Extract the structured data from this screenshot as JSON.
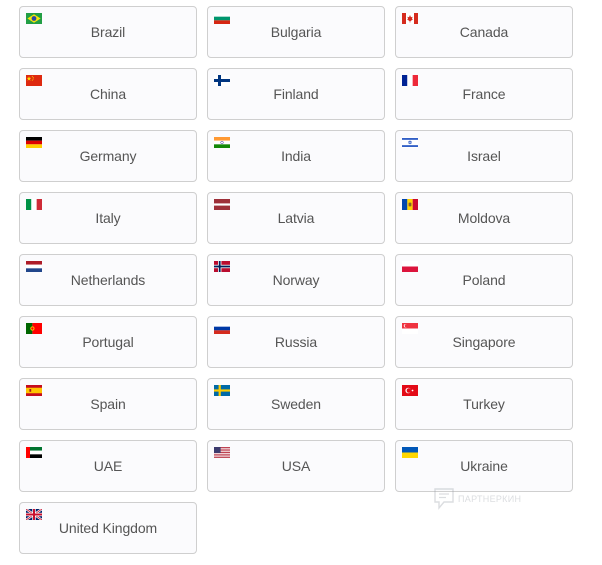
{
  "countries": [
    {
      "name": "Brazil",
      "flag": "brazil-flag-icon"
    },
    {
      "name": "Bulgaria",
      "flag": "bulgaria-flag-icon"
    },
    {
      "name": "Canada",
      "flag": "canada-flag-icon"
    },
    {
      "name": "China",
      "flag": "china-flag-icon"
    },
    {
      "name": "Finland",
      "flag": "finland-flag-icon"
    },
    {
      "name": "France",
      "flag": "france-flag-icon"
    },
    {
      "name": "Germany",
      "flag": "germany-flag-icon"
    },
    {
      "name": "India",
      "flag": "india-flag-icon"
    },
    {
      "name": "Israel",
      "flag": "israel-flag-icon"
    },
    {
      "name": "Italy",
      "flag": "italy-flag-icon"
    },
    {
      "name": "Latvia",
      "flag": "latvia-flag-icon"
    },
    {
      "name": "Moldova",
      "flag": "moldova-flag-icon"
    },
    {
      "name": "Netherlands",
      "flag": "netherlands-flag-icon"
    },
    {
      "name": "Norway",
      "flag": "norway-flag-icon"
    },
    {
      "name": "Poland",
      "flag": "poland-flag-icon"
    },
    {
      "name": "Portugal",
      "flag": "portugal-flag-icon"
    },
    {
      "name": "Russia",
      "flag": "russia-flag-icon"
    },
    {
      "name": "Singapore",
      "flag": "singapore-flag-icon"
    },
    {
      "name": "Spain",
      "flag": "spain-flag-icon"
    },
    {
      "name": "Sweden",
      "flag": "sweden-flag-icon"
    },
    {
      "name": "Turkey",
      "flag": "turkey-flag-icon"
    },
    {
      "name": "UAE",
      "flag": "uae-flag-icon"
    },
    {
      "name": "USA",
      "flag": "usa-flag-icon"
    },
    {
      "name": "Ukraine",
      "flag": "ukraine-flag-icon"
    },
    {
      "name": "United Kingdom",
      "flag": "united-kingdom-flag-icon"
    }
  ],
  "watermark": {
    "text": "ПАРТНЕРКИН"
  }
}
